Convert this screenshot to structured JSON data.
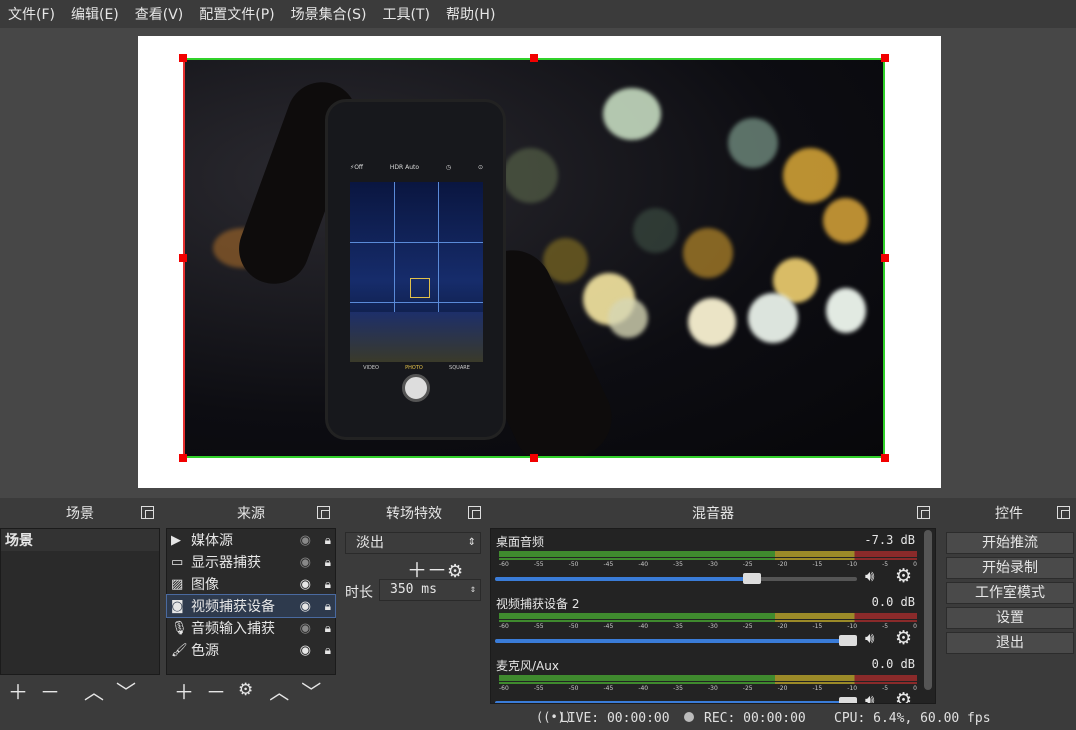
{
  "menu": [
    "文件(F)",
    "编辑(E)",
    "查看(V)",
    "配置文件(P)",
    "场景集合(S)",
    "工具(T)",
    "帮助(H)"
  ],
  "phone": {
    "labels": {
      "flash": "⚡Off",
      "hdr": "HDR Auto",
      "modes": [
        "VIDEO",
        "PHOTO",
        "SQUARE"
      ]
    }
  },
  "docks": {
    "scenes": "场景",
    "sources": "来源",
    "transitions": "转场特效",
    "mixer": "混音器",
    "controls": "控件"
  },
  "scenes": [
    "场景"
  ],
  "sources": [
    {
      "label": "媒体源",
      "icon": "play-icon",
      "visible": false,
      "locked": true
    },
    {
      "label": "显示器捕获",
      "icon": "monitor-icon",
      "visible": false,
      "locked": true
    },
    {
      "label": "图像",
      "icon": "image-icon",
      "visible": true,
      "locked": true
    },
    {
      "label": "视频捕获设备",
      "icon": "camera-icon",
      "visible": true,
      "locked": true,
      "selected": true
    },
    {
      "label": "音频输入捕获",
      "icon": "mic-icon",
      "visible": false,
      "locked": true
    },
    {
      "label": "色源",
      "icon": "brush-icon",
      "visible": true,
      "locked": true
    }
  ],
  "transition": {
    "type": "淡出",
    "duration_label": "时长",
    "duration": "350 ms"
  },
  "mixer": [
    {
      "name": "桌面音频",
      "db": "-7.3 dB",
      "volume": 0.72
    },
    {
      "name": "视频捕获设备 2",
      "db": "0.0 dB",
      "volume": 1.0
    },
    {
      "name": "麦克风/Aux",
      "db": "0.0 dB",
      "volume": 1.0
    }
  ],
  "meter_ticks": [
    "-60",
    "-55",
    "-50",
    "-45",
    "-40",
    "-35",
    "-30",
    "-25",
    "-20",
    "-15",
    "-10",
    "-5",
    "0"
  ],
  "controls": [
    "开始推流",
    "开始录制",
    "工作室模式",
    "设置",
    "退出"
  ],
  "status": {
    "live": "LIVE: 00:00:00",
    "rec": "REC: 00:00:00",
    "cpu": "CPU: 6.4%, 60.00 fps"
  },
  "colors": {
    "selection_border": "#31d12a",
    "handle": "#f20000",
    "accent": "#3a7cd8"
  }
}
